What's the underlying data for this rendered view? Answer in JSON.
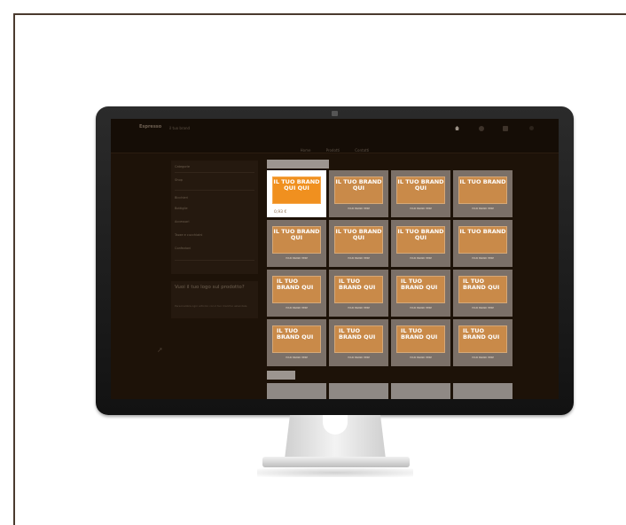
{
  "site": {
    "logo": "Espresso",
    "tagline": "il tuo brand",
    "nav": [
      "Home",
      "Prodotti",
      "Contatti"
    ]
  },
  "sidebar": {
    "items": [
      "Categorie",
      "Shop",
      "Bicchieri",
      "Bottiglie",
      "Accessori",
      "Tazze e cucchiaini",
      "Confezioni"
    ],
    "promo_title": "Vuoi il tuo logo sul prodotto?",
    "promo_text": "Personalizza ogni articolo con il tuo marchio aziendale"
  },
  "grid": {
    "tiles": [
      {
        "title": "IL TUO BRAND QUI QUI",
        "subtitle": "",
        "price": "0,93 €",
        "selected": true
      },
      {
        "title": "IL TUO BRAND QUI",
        "subtitle": "YOUR BRAND HERE",
        "price": "",
        "selected": false
      },
      {
        "title": "IL TUO BRAND QUI",
        "subtitle": "YOUR BRAND HERE",
        "price": "",
        "selected": false
      },
      {
        "title": "IL TUO BRAND",
        "subtitle": "YOUR BRAND HERE",
        "price": "",
        "selected": false
      },
      {
        "title": "IL TUO BRAND QUI",
        "subtitle": "YOUR BRAND HERE",
        "price": "",
        "selected": false
      },
      {
        "title": "IL TUO BRAND QUI",
        "subtitle": "YOUR BRAND HERE",
        "price": "",
        "selected": false
      },
      {
        "title": "IL TUO BRAND QUI",
        "subtitle": "YOUR BRAND HERE",
        "price": "",
        "selected": false
      },
      {
        "title": "IL TUO BRAND",
        "subtitle": "YOUR BRAND HERE",
        "price": "",
        "selected": false
      },
      {
        "title": "IL TUO BRAND QUI",
        "subtitle": "YOUR BRAND HERE",
        "price": "",
        "selected": false
      },
      {
        "title": "IL TUO BRAND QUI",
        "subtitle": "YOUR BRAND HERE",
        "price": "",
        "selected": false
      },
      {
        "title": "IL TUO BRAND QUI",
        "subtitle": "YOUR BRAND HERE",
        "price": "",
        "selected": false
      },
      {
        "title": "IL TUO BRAND QUI",
        "subtitle": "YOUR BRAND HERE",
        "price": "",
        "selected": false
      },
      {
        "title": "IL TUO BRAND QUI",
        "subtitle": "YOUR BRAND HERE",
        "price": "",
        "selected": false
      },
      {
        "title": "IL TUO BRAND QUI",
        "subtitle": "YOUR BRAND HERE",
        "price": "",
        "selected": false
      },
      {
        "title": "IL TUO BRAND QUI",
        "subtitle": "YOUR BRAND HERE",
        "price": "",
        "selected": false
      },
      {
        "title": "IL TUO BRAND QUI",
        "subtitle": "YOUR BRAND HERE",
        "price": "",
        "selected": false
      }
    ]
  },
  "icons": {
    "header_right": [
      "home-icon",
      "user-icon",
      "cart-icon",
      "menu-icon"
    ],
    "sidebar": "arrow-icon"
  },
  "colors": {
    "accent": "#f0901f",
    "badge": "#c98a49",
    "tile": "#7b7068",
    "page_background": "#1d1208"
  }
}
